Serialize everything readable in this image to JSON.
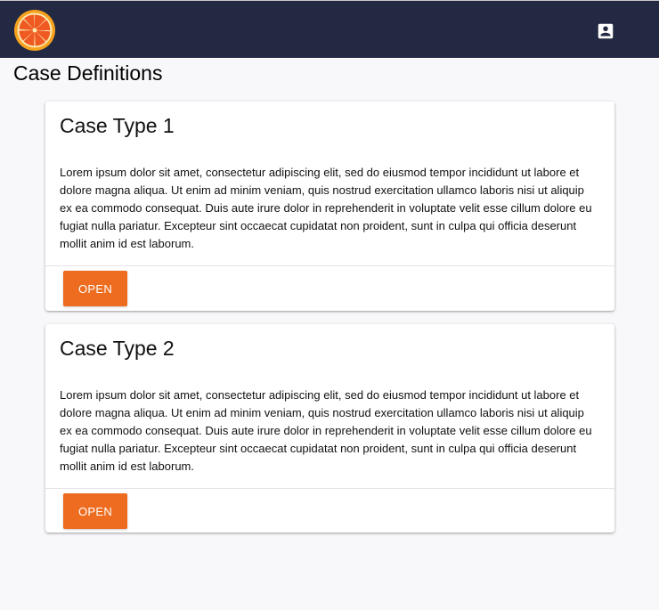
{
  "header": {
    "logo_icon": "orange-slice-icon",
    "account_icon": "account-box-icon",
    "background_color": "#232942"
  },
  "page": {
    "title": "Case Definitions"
  },
  "cards": [
    {
      "title": "Case Type 1",
      "body": "Lorem ipsum dolor sit amet, consectetur adipiscing elit, sed do eiusmod tempor incididunt ut labore et dolore magna aliqua. Ut enim ad minim veniam, quis nostrud exercitation ullamco laboris nisi ut aliquip ex ea commodo consequat. Duis aute irure dolor in reprehenderit in voluptate velit esse cillum dolore eu fugiat nulla pariatur. Excepteur sint occaecat cupidatat non proident, sunt in culpa qui officia deserunt mollit anim id est laborum.",
      "button_label": "OPEN"
    },
    {
      "title": "Case Type 2",
      "body": "Lorem ipsum dolor sit amet, consectetur adipiscing elit, sed do eiusmod tempor incididunt ut labore et dolore magna aliqua. Ut enim ad minim veniam, quis nostrud exercitation ullamco laboris nisi ut aliquip ex ea commodo consequat. Duis aute irure dolor in reprehenderit in voluptate velit esse cillum dolore eu fugiat nulla pariatur. Excepteur sint occaecat cupidatat non proident, sunt in culpa qui officia deserunt mollit anim id est laborum.",
      "button_label": "OPEN"
    }
  ],
  "colors": {
    "accent": "#ee6c1f",
    "page_background": "#f8f8fa"
  }
}
